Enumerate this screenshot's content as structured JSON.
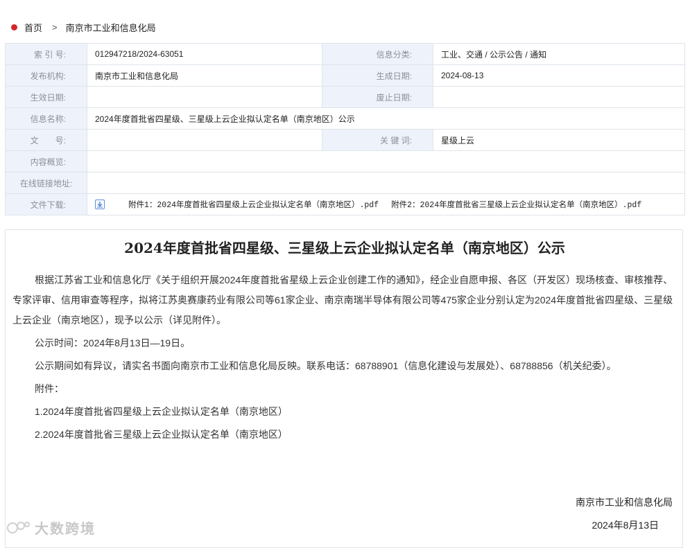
{
  "breadcrumb": {
    "home": "首页",
    "separator": ">",
    "current": "南京市工业和信息化局"
  },
  "meta": {
    "index_label": "索 引 号:",
    "index_value": "012947218/2024-63051",
    "category_label": "信息分类:",
    "category_value": "工业、交通 / 公示公告 / 通知",
    "publisher_label": "发布机构:",
    "publisher_value": "南京市工业和信息化局",
    "created_label": "生成日期:",
    "created_value": "2024-08-13",
    "effective_label": "生效日期:",
    "effective_value": "",
    "abolished_label": "废止日期:",
    "abolished_value": "",
    "name_label": "信息名称:",
    "name_value": "2024年度首批省四星级、三星级上云企业拟认定名单（南京地区）公示",
    "docno_label": "文　　号:",
    "docno_value": "",
    "keywords_label": "关 键 词:",
    "keywords_value": "星级上云",
    "overview_label": "内容概览:",
    "overview_value": "",
    "online_label": "在线链接地址:",
    "online_value": "",
    "download_label": "文件下载:",
    "attachments": [
      "附件1：2024年度首批省四星级上云企业拟认定名单（南京地区）.pdf",
      "附件2：2024年度首批省三星级上云企业拟认定名单（南京地区）.pdf"
    ]
  },
  "article": {
    "title": "2024年度首批省四星级、三星级上云企业拟认定名单（南京地区）公示",
    "paragraph1": "根据江苏省工业和信息化厅《关于组织开展2024年度首批省星级上云企业创建工作的通知》，经企业自愿申报、各区（开发区）现场核查、审核推荐、专家评审、信用审查等程序，拟将江苏奥赛康药业有限公司等61家企业、南京南瑞半导体有限公司等475家企业分别认定为2024年度首批省四星级、三星级上云企业（南京地区），现予以公示（详见附件）。",
    "period": "公示时间：2024年8月13日—19日。",
    "objection": "公示期间如有异议，请实名书面向南京市工业和信息化局反映。联系电话：68788901（信息化建设与发展处）、68788856（机关纪委）。",
    "attachments_heading": "附件：",
    "attachment1": "1.2024年度首批省四星级上云企业拟认定名单（南京地区）",
    "attachment2": "2.2024年度首批省三星级上云企业拟认定名单（南京地区）",
    "signature": "南京市工业和信息化局",
    "sign_date": "2024年8月13日"
  },
  "watermark": {
    "text": "大数跨境"
  },
  "colors": {
    "label_bg": "#eef3fb",
    "border": "#dfe3ea",
    "home_dot": "#d0282a",
    "icon_blue": "#5a8ede"
  }
}
